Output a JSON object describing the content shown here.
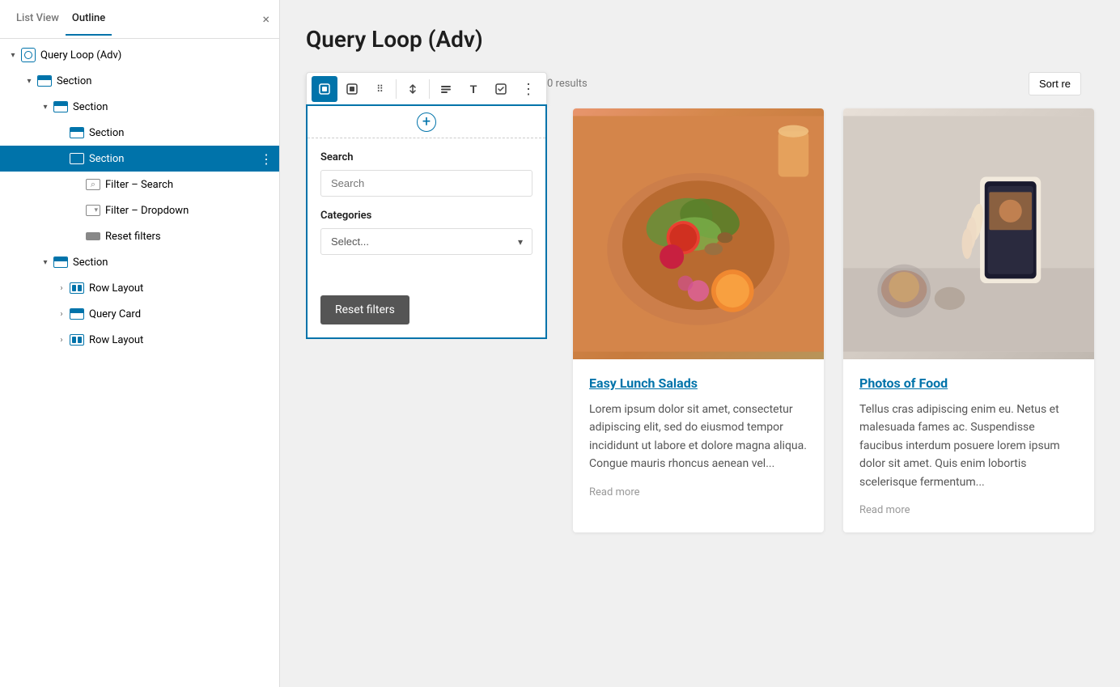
{
  "sidebar": {
    "tabs": [
      {
        "id": "list-view",
        "label": "List View"
      },
      {
        "id": "outline",
        "label": "Outline"
      }
    ],
    "active_tab": "outline",
    "close_label": "×",
    "tree": [
      {
        "id": "root",
        "label": "Query Loop (Adv)",
        "icon": "query-loop",
        "indent": 0,
        "toggle": "open",
        "selected": false
      },
      {
        "id": "s1",
        "label": "Section",
        "icon": "section",
        "indent": 1,
        "toggle": "open",
        "selected": false
      },
      {
        "id": "s2",
        "label": "Section",
        "icon": "section",
        "indent": 2,
        "toggle": "open",
        "selected": false
      },
      {
        "id": "s3",
        "label": "Section",
        "icon": "section",
        "indent": 3,
        "toggle": "leaf",
        "selected": false
      },
      {
        "id": "s4",
        "label": "Section",
        "icon": "section",
        "indent": 3,
        "toggle": "leaf",
        "selected": true
      },
      {
        "id": "fs",
        "label": "Filter – Search",
        "icon": "filter-search",
        "indent": 4,
        "toggle": "leaf",
        "selected": false
      },
      {
        "id": "fd",
        "label": "Filter – Dropdown",
        "icon": "filter-dropdown",
        "indent": 4,
        "toggle": "leaf",
        "selected": false
      },
      {
        "id": "rf",
        "label": "Reset filters",
        "icon": "reset",
        "indent": 4,
        "toggle": "leaf",
        "selected": false
      },
      {
        "id": "s5",
        "label": "Section",
        "icon": "section",
        "indent": 2,
        "toggle": "open",
        "selected": false
      },
      {
        "id": "rl1",
        "label": "Row Layout",
        "icon": "row-layout",
        "indent": 3,
        "toggle": "closed",
        "selected": false
      },
      {
        "id": "qc",
        "label": "Query Card",
        "icon": "query-card",
        "indent": 3,
        "toggle": "closed",
        "selected": false
      },
      {
        "id": "rl2",
        "label": "Row Layout",
        "icon": "row-layout",
        "indent": 3,
        "toggle": "closed",
        "selected": false
      }
    ]
  },
  "toolbar": {
    "buttons": [
      {
        "id": "select-parent",
        "icon": "◎",
        "active": true,
        "label": "Select parent"
      },
      {
        "id": "select-block",
        "icon": "◎",
        "active": false,
        "label": "Select block"
      },
      {
        "id": "drag",
        "icon": "⠿",
        "active": false,
        "label": "Drag"
      },
      {
        "id": "move",
        "icon": "↑↓",
        "active": false,
        "label": "Move up/down"
      },
      {
        "id": "align",
        "icon": "≡",
        "active": false,
        "label": "Align"
      },
      {
        "id": "type",
        "icon": "T",
        "active": false,
        "label": "Text type"
      },
      {
        "id": "edit",
        "icon": "✎",
        "active": false,
        "label": "Edit"
      },
      {
        "id": "more",
        "icon": "⋮",
        "active": false,
        "label": "More options"
      }
    ]
  },
  "filter_panel": {
    "add_btn": "+",
    "search_label": "Search",
    "search_placeholder": "Search",
    "categories_label": "Categories",
    "select_placeholder": "Select...",
    "reset_btn_label": "Reset filters"
  },
  "results": {
    "count_text": "0 results",
    "sort_label": "Sort re"
  },
  "posts": [
    {
      "id": "p1",
      "title": "Easy Lunch Salads",
      "excerpt": "Lorem ipsum dolor sit amet, consectetur adipiscing elit, sed do eiusmod tempor incididunt ut labore et dolore magna aliqua. Congue mauris rhoncus aenean vel...",
      "read_more": "Read more",
      "img_type": "salad"
    },
    {
      "id": "p2",
      "title": "Photos of Food",
      "excerpt": "Tellus cras adipiscing enim eu. Netus et malesuada fames ac. Suspendisse faucibus interdum posuere lorem ipsum dolor sit amet. Quis enim lobortis scelerisque fermentum...",
      "read_more": "Read more",
      "img_type": "food"
    }
  ],
  "page": {
    "title": "Query Loop (Adv)"
  }
}
